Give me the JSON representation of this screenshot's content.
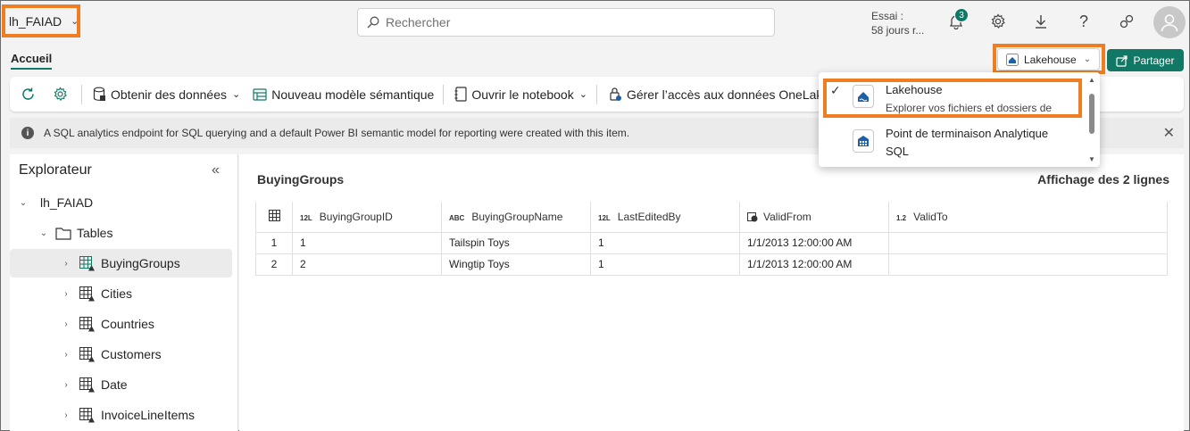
{
  "workspace": {
    "name": "lh_FAIAD"
  },
  "search": {
    "placeholder": "Rechercher"
  },
  "trial": {
    "line1": "Essai :",
    "line2": "58 jours r..."
  },
  "notifications": {
    "count": "3"
  },
  "tabs": {
    "home": "Accueil"
  },
  "view_switcher": {
    "label": "Lakehouse"
  },
  "share": {
    "label": "Partager"
  },
  "ribbon": {
    "get_data": "Obtenir des données",
    "new_semantic_model": "Nouveau modèle sémantique",
    "open_notebook": "Ouvrir le notebook",
    "manage_access": "Gérer l’accès aux données OneLake ("
  },
  "infobar": {
    "message": "A SQL analytics endpoint for SQL querying and a default Power BI semantic model for reporting were created with this item."
  },
  "explorer": {
    "title": "Explorateur",
    "root": "lh_FAIAD",
    "tables_folder": "Tables",
    "tables": [
      "BuyingGroups",
      "Cities",
      "Countries",
      "Customers",
      "Date",
      "InvoiceLineItems"
    ]
  },
  "table_view": {
    "title": "BuyingGroups",
    "row_count": "Affichage des 2 lignes",
    "columns": [
      {
        "type": "12L",
        "name": "BuyingGroupID"
      },
      {
        "type": "ABC",
        "name": "BuyingGroupName"
      },
      {
        "type": "12L",
        "name": "LastEditedBy"
      },
      {
        "type": "clock",
        "name": "ValidFrom"
      },
      {
        "type": "1.2",
        "name": "ValidTo"
      }
    ],
    "rows": [
      {
        "n": "1",
        "cells": [
          "1",
          "Tailspin Toys",
          "1",
          "1/1/2013 12:00:00 AM",
          ""
        ]
      },
      {
        "n": "2",
        "cells": [
          "2",
          "Wingtip Toys",
          "1",
          "1/1/2013 12:00:00 AM",
          ""
        ]
      }
    ]
  },
  "dropdown": {
    "items": [
      {
        "title": "Lakehouse",
        "subtitle": "Explorer vos fichiers et dossiers de",
        "checked": true
      },
      {
        "title": "Point de terminaison Analytique",
        "subtitle": "SQL",
        "checked": false
      }
    ]
  },
  "colors": {
    "accent": "#117865",
    "highlight": "#ef7d22"
  }
}
